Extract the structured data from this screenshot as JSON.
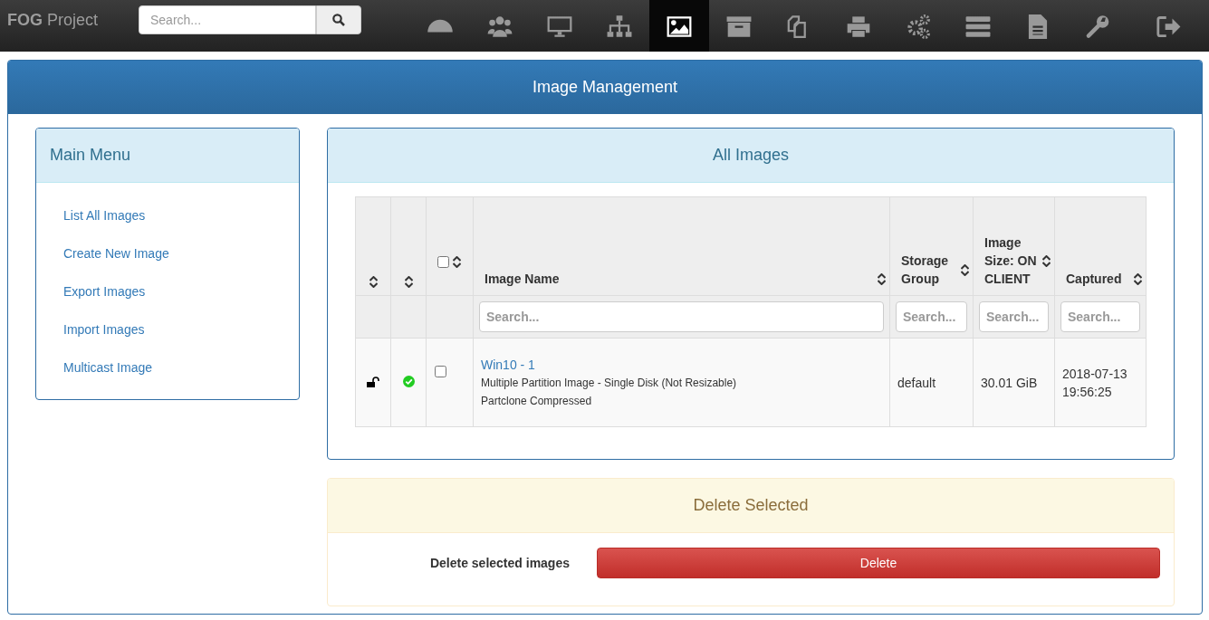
{
  "navbar": {
    "brand": "**FOG** Project",
    "search": {
      "placeholder": "Search..."
    },
    "items": [
      {
        "kind": "dashboard",
        "selected": false
      },
      {
        "kind": "users",
        "selected": false
      },
      {
        "kind": "hosts",
        "selected": false
      },
      {
        "kind": "groups",
        "selected": false
      },
      {
        "kind": "images",
        "selected": true
      },
      {
        "kind": "storage",
        "selected": false
      },
      {
        "kind": "snapins",
        "selected": false
      },
      {
        "kind": "printers",
        "selected": false
      },
      {
        "kind": "services",
        "selected": false
      },
      {
        "kind": "tasks",
        "selected": false
      },
      {
        "kind": "reports",
        "selected": false
      },
      {
        "kind": "settings",
        "selected": false
      },
      {
        "kind": "logout",
        "selected": false
      }
    ]
  },
  "page": {
    "title": "Image Management"
  },
  "main_menu": {
    "title": "Main Menu",
    "items": [
      "List All Images",
      "Create New Image",
      "Export Images",
      "Import Images",
      "Multicast Image"
    ]
  },
  "images": {
    "title": "All Images",
    "table": {
      "columns": [
        {
          "kind": "protected"
        },
        {
          "kind": "enabled"
        },
        {
          "kind": "select",
          "checked": false
        },
        {
          "kind": "text",
          "label": "Image Name",
          "placeholder": "Search..."
        },
        {
          "kind": "text",
          "label": "Storage Group",
          "placeholder": "Search..."
        },
        {
          "kind": "text",
          "label": "Image Size: ON CLIENT",
          "placeholder": "Search..."
        },
        {
          "kind": "text",
          "label": "Captured",
          "placeholder": "Search..."
        }
      ],
      "rows": [
        {
          "protected": false,
          "enabled": true,
          "checked": false,
          "name": "Win10 - 1",
          "details": [
            "Multiple Partition Image - Single Disk (Not Resizable)",
            "Partclone Compressed"
          ],
          "storage_group": "default",
          "size": "30.01 GiB",
          "captured": "2018-07-13 19:56:25"
        }
      ]
    }
  },
  "delete": {
    "title": "Delete Selected",
    "label": "Delete selected images",
    "button": "Delete"
  }
}
